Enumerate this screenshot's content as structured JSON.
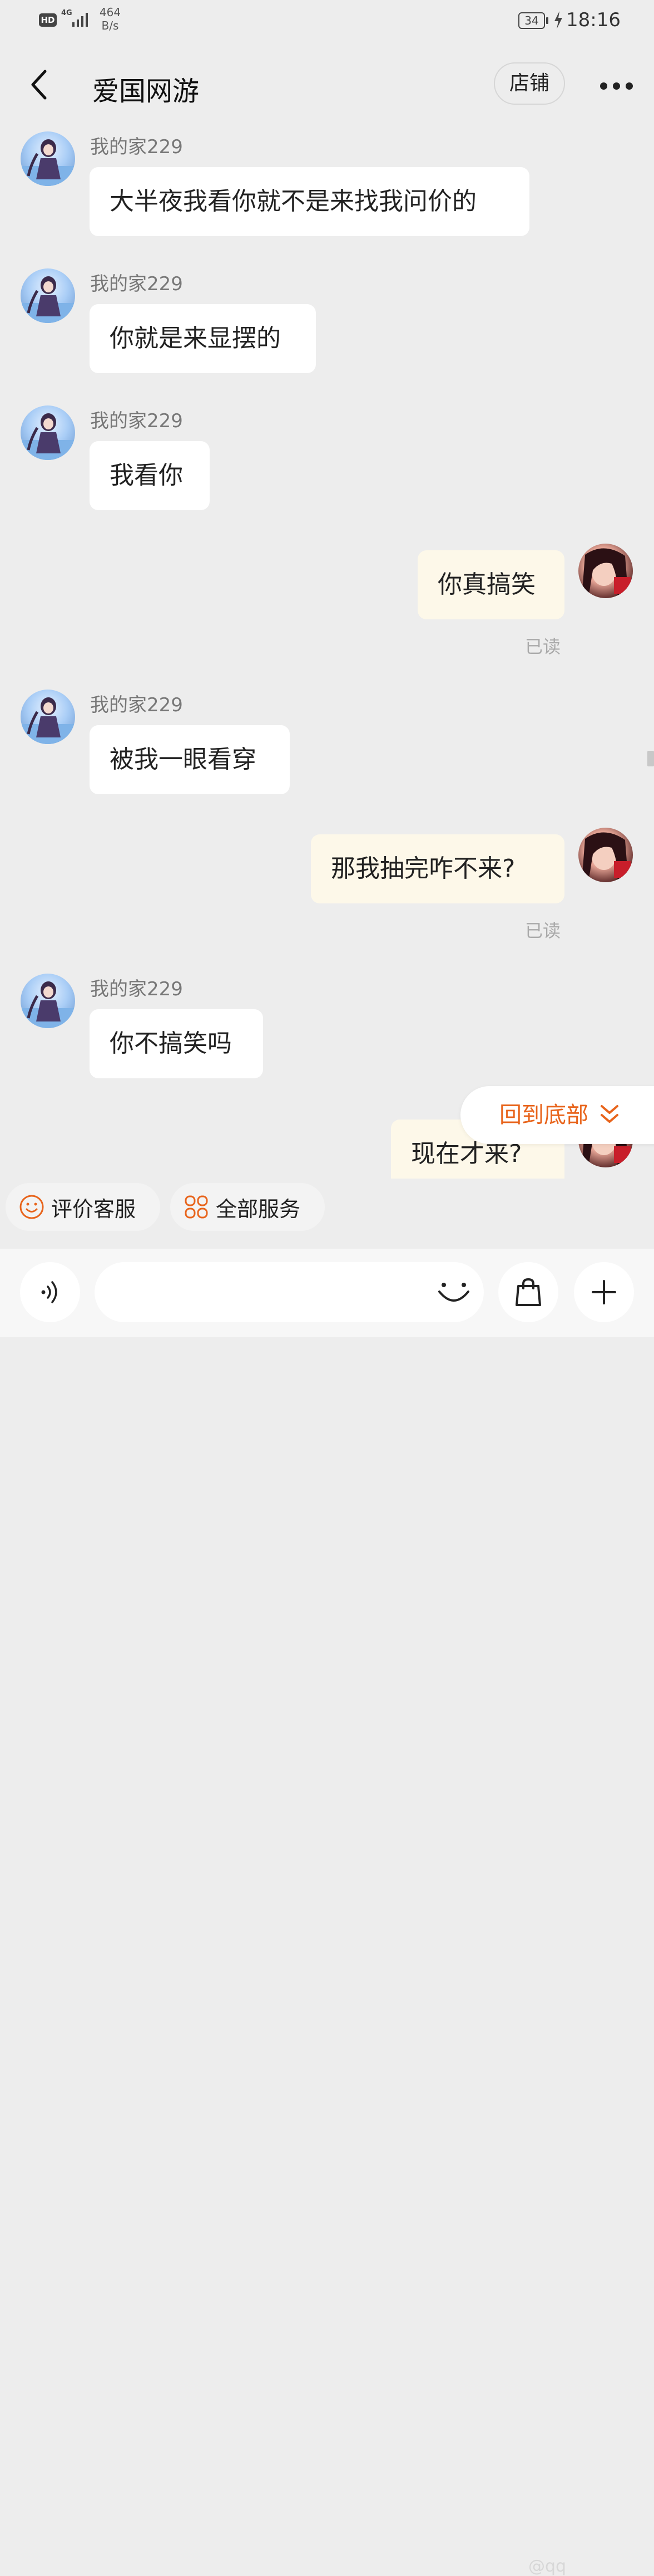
{
  "status_bar": {
    "hd": "HD",
    "network": "4G",
    "speed_value": "464",
    "speed_unit": "B/s",
    "battery": "34",
    "time": "18:16",
    "icons": [
      "hd-icon",
      "signal-icon",
      "battery-icon",
      "charging-bolt-icon"
    ]
  },
  "header": {
    "title": "爱国网游",
    "shop_label": "店铺",
    "icons": [
      "back-arrow-icon",
      "more-dots-icon"
    ]
  },
  "messages": [
    {
      "side": "in",
      "sender": "我的家229",
      "text": "大半夜我看你就不是来找我问价的"
    },
    {
      "side": "in",
      "sender": "我的家229",
      "text": "你就是来显摆的"
    },
    {
      "side": "in",
      "sender": "我的家229",
      "text": "我看你"
    },
    {
      "side": "out",
      "text": "你真搞笑",
      "status": "已读"
    },
    {
      "side": "in",
      "sender": "我的家229",
      "text": "被我一眼看穿"
    },
    {
      "side": "out",
      "text": "那我抽完咋不来?",
      "status": "已读"
    },
    {
      "side": "in",
      "sender": "我的家229",
      "text": "你不搞笑吗"
    },
    {
      "side": "out",
      "text": "现在才来?"
    }
  ],
  "back_to_bottom": {
    "label": "回到底部",
    "icon": "double-chevron-down-icon"
  },
  "quick_actions": [
    {
      "label": "评价客服",
      "icon": "smiley-icon"
    },
    {
      "label": "全部服务",
      "icon": "grid-services-icon"
    }
  ],
  "input_bar": {
    "placeholder": "",
    "icons": [
      "voice-icon",
      "emoji-icon",
      "shopping-bag-icon",
      "plus-icon"
    ]
  },
  "watermark": "@qq",
  "colors": {
    "background": "#ededed",
    "bubble_in": "#ffffff",
    "bubble_out": "#fdf8e9",
    "accent": "#e8641b"
  }
}
